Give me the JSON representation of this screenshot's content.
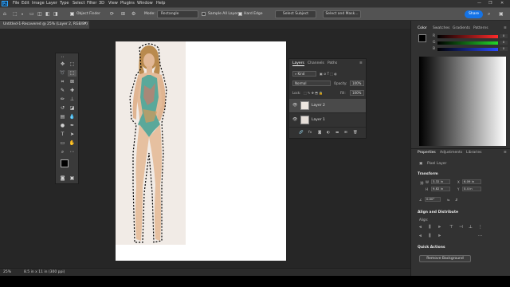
{
  "menubar": {
    "logo": "Ps",
    "items": [
      "File",
      "Edit",
      "Image",
      "Layer",
      "Type",
      "Select",
      "Filter",
      "3D",
      "View",
      "Plugins",
      "Window",
      "Help"
    ],
    "window_controls": [
      "—",
      "❐",
      "✕"
    ]
  },
  "options": {
    "object_finder_label": "Object Finder",
    "mode_label": "Mode:",
    "mode_value": "Rectangle",
    "sample_all_layers_label": "Sample All Layers",
    "hard_edge_label": "Hard Edge",
    "select_subject_label": "Select Subject",
    "select_and_mask_label": "Select and Mask...",
    "share_label": "Share"
  },
  "document": {
    "tab_title": "Untitled-1-Recovered @ 25% (Layer 2, RGB/8*)",
    "close_glyph": "✕"
  },
  "layers_panel": {
    "tabs": [
      "Layers",
      "Channels",
      "Paths"
    ],
    "kind_label": "Kind",
    "blend_mode": "Normal",
    "opacity_label": "Opacity:",
    "opacity_value": "100%",
    "lock_label": "Lock:",
    "fill_label": "Fill:",
    "fill_value": "100%",
    "layers": [
      {
        "name": "Layer 2"
      },
      {
        "name": "Layer 1"
      }
    ],
    "footer_icons": [
      "link",
      "fx",
      "mask",
      "adjust",
      "group",
      "new",
      "trash"
    ]
  },
  "color_panel": {
    "tabs": [
      "Color",
      "Swatches",
      "Gradients",
      "Patterns"
    ],
    "sliders": [
      {
        "label": "R",
        "value": "0",
        "color": "#ff2a2a"
      },
      {
        "label": "G",
        "value": "0",
        "color": "#22d62a"
      },
      {
        "label": "B",
        "value": "0",
        "color": "#2a4aff"
      }
    ]
  },
  "properties_panel": {
    "tabs": [
      "Properties",
      "Adjustments",
      "Libraries"
    ],
    "layer_type": "Pixel Layer",
    "transform_title": "Transform",
    "w_label": "W",
    "w_value": "3.32 in",
    "x_label": "X",
    "x_value": "6.09 in",
    "h_label": "H",
    "h_value": "9.82 in",
    "y_label": "Y",
    "y_value": "0.4 in",
    "angle_value": "0.00°",
    "align_title": "Align and Distribute",
    "align_sub": "Align:",
    "quick_actions_title": "Quick Actions",
    "remove_bg_label": "Remove Background"
  },
  "statusbar": {
    "zoom": "25%",
    "doc_info": "8.5 in x 11 in (300 ppi)"
  },
  "colors": {
    "accent": "#1473e6",
    "panel_bg": "#323232",
    "canvas_bg": "#262626"
  }
}
